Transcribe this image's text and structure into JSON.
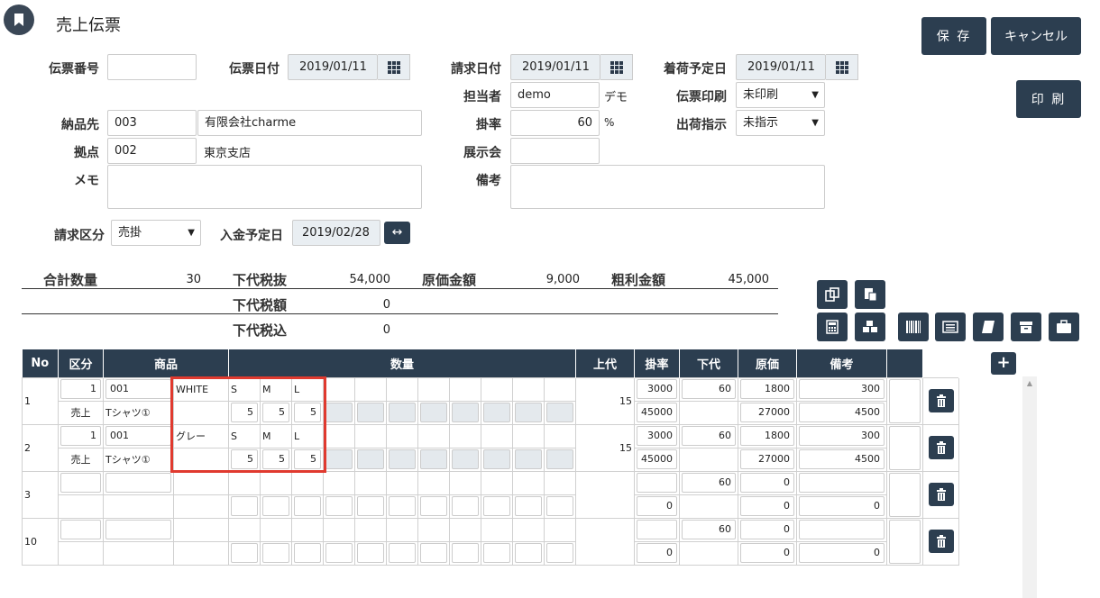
{
  "header": {
    "title": "売上伝票",
    "save": "保 存",
    "cancel": "キャンセル",
    "print": "印 刷"
  },
  "form": {
    "denpyo_no": {
      "label": "伝票番号",
      "value": ""
    },
    "denpyo_date": {
      "label": "伝票日付",
      "value": "2019/01/11"
    },
    "seikyu_date": {
      "label": "請求日付",
      "value": "2019/01/11"
    },
    "chakuni_date": {
      "label": "着荷予定日",
      "value": "2019/01/11"
    },
    "tanto": {
      "label": "担当者",
      "value": "demo",
      "name": "デモ"
    },
    "print_status": {
      "label": "伝票印刷",
      "value": "未印刷"
    },
    "nohin": {
      "label": "納品先",
      "code": "003",
      "name": "有限会社charme"
    },
    "rate": {
      "label": "掛率",
      "value": "60",
      "unit": "%"
    },
    "ship": {
      "label": "出荷指示",
      "value": "未指示"
    },
    "kyoten": {
      "label": "拠点",
      "code": "002",
      "name": "東京支店"
    },
    "tenjikai": {
      "label": "展示会",
      "value": ""
    },
    "memo": {
      "label": "メモ",
      "value": ""
    },
    "biko": {
      "label": "備考",
      "value": ""
    },
    "seikyu_kubun": {
      "label": "請求区分",
      "value": "売掛"
    },
    "nyukin_date": {
      "label": "入金予定日",
      "value": "2019/02/28"
    }
  },
  "summary": {
    "total_qty": {
      "label": "合計数量",
      "value": "30"
    },
    "gedai_nuki": {
      "label": "下代税抜",
      "value": "54,000"
    },
    "genka": {
      "label": "原価金額",
      "value": "9,000"
    },
    "arari": {
      "label": "粗利金額",
      "value": "45,000"
    },
    "gedai_zei": {
      "label": "下代税額",
      "value": "0"
    },
    "gedai_komi": {
      "label": "下代税込",
      "value": "0"
    }
  },
  "table": {
    "headers": [
      "No",
      "区分",
      "商品",
      "数量",
      "上代",
      "掛率",
      "下代",
      "原価",
      "備考"
    ],
    "rows": [
      {
        "no": "1",
        "kubun_code": "1",
        "kubun": "売上",
        "item_code": "001",
        "item_name": "Tシャツ①",
        "color": "WHITE",
        "sizes": [
          "S",
          "M",
          "L"
        ],
        "qtys": [
          "5",
          "5",
          "5"
        ],
        "count": "15",
        "jodai": "3000",
        "jodai_amt": "45000",
        "rate": "60",
        "gedai": "1800",
        "gedai_amt": "27000",
        "genka": "300",
        "genka_amt": "4500"
      },
      {
        "no": "2",
        "kubun_code": "1",
        "kubun": "売上",
        "item_code": "001",
        "item_name": "Tシャツ①",
        "color": "グレー",
        "sizes": [
          "S",
          "M",
          "L"
        ],
        "qtys": [
          "5",
          "5",
          "5"
        ],
        "count": "15",
        "jodai": "3000",
        "jodai_amt": "45000",
        "rate": "60",
        "gedai": "1800",
        "gedai_amt": "27000",
        "genka": "300",
        "genka_amt": "4500"
      },
      {
        "no": "3",
        "rate": "60",
        "jodai_amt": "0",
        "gedai": "0",
        "gedai_amt": "0",
        "genka_amt": "0"
      },
      {
        "no": "10",
        "rate": "60",
        "jodai_amt": "0",
        "gedai": "0",
        "gedai_amt": "0",
        "genka_amt": "0"
      }
    ]
  },
  "colors": {
    "navy": "#2c3e50",
    "highlight": "#e03a2f"
  }
}
